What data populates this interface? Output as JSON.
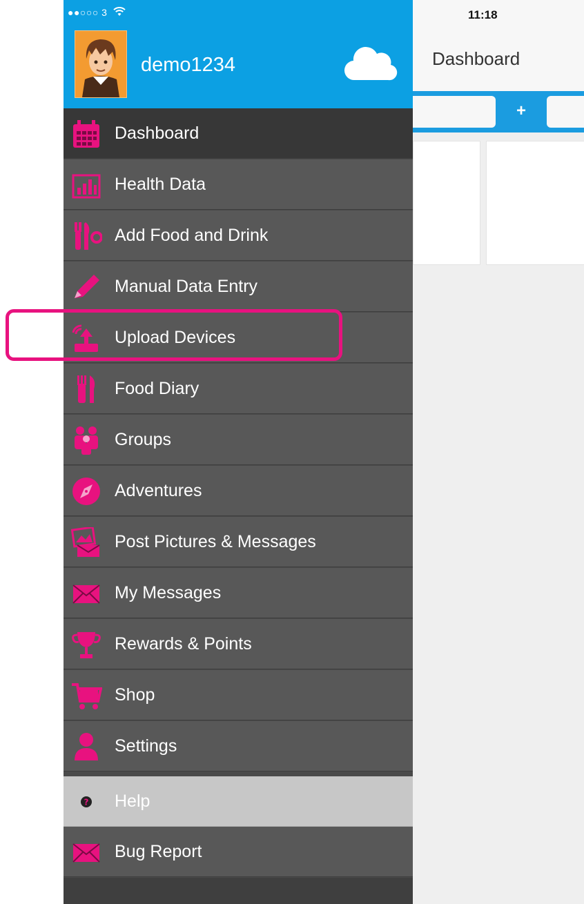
{
  "status": {
    "carrier": "●●○○○ 3",
    "time": "11:18"
  },
  "header": {
    "title": "Dashboard"
  },
  "tabs": {
    "add_label": "+"
  },
  "sidebar": {
    "username": "demo1234",
    "items": [
      {
        "label": "Dashboard",
        "icon": "calendar-icon",
        "active": true
      },
      {
        "label": "Health Data",
        "icon": "bar-chart-icon"
      },
      {
        "label": "Add Food and Drink",
        "icon": "cutlery-icon"
      },
      {
        "label": "Manual Data Entry",
        "icon": "pencil-icon"
      },
      {
        "label": "Upload Devices",
        "icon": "upload-device-icon"
      },
      {
        "label": "Food Diary",
        "icon": "fork-knife-icon"
      },
      {
        "label": "Groups",
        "icon": "group-icon"
      },
      {
        "label": "Adventures",
        "icon": "compass-icon"
      },
      {
        "label": "Post Pictures & Messages",
        "icon": "picture-message-icon"
      },
      {
        "label": "My Messages",
        "icon": "envelope-icon"
      },
      {
        "label": "Rewards & Points",
        "icon": "trophy-icon"
      },
      {
        "label": "Shop",
        "icon": "cart-icon"
      },
      {
        "label": "Settings",
        "icon": "person-icon"
      },
      {
        "label": "Help",
        "icon": "help-icon"
      },
      {
        "label": "Bug Report",
        "icon": "envelope-icon"
      }
    ]
  },
  "colors": {
    "accent": "#e8127f",
    "header_blue": "#0ca0e3",
    "menu_bg": "#585858",
    "menu_active_bg": "#373737",
    "help_bg": "#c7c7c7"
  }
}
